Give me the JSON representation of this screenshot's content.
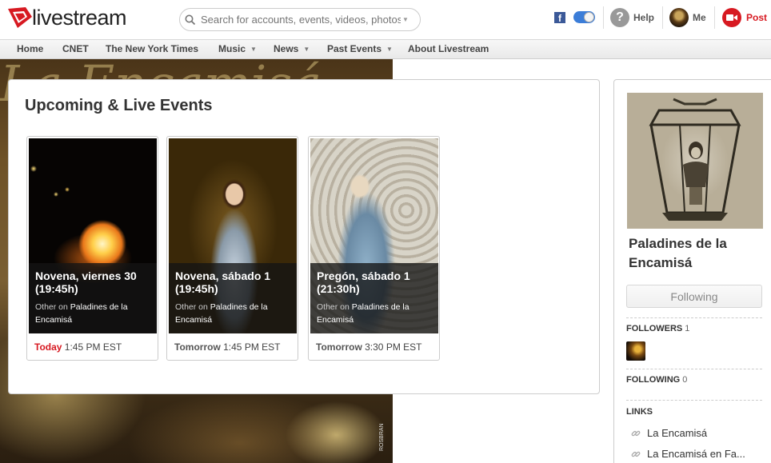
{
  "header": {
    "logo_text": "livestream",
    "search_placeholder": "Search for accounts, events, videos, photos...",
    "fb_glyph": "f",
    "help_label": "Help",
    "me_label": "Me",
    "post_label": "Post"
  },
  "nav": {
    "items": [
      {
        "label": "Home"
      },
      {
        "label": "CNET"
      },
      {
        "label": "The New York Times"
      },
      {
        "label": "Music",
        "dropdown": true
      },
      {
        "label": "News",
        "dropdown": true
      },
      {
        "label": "Past Events",
        "dropdown": true
      },
      {
        "label": "About Livestream"
      }
    ]
  },
  "background": {
    "script_text": "La Encamisá",
    "watermark": "ROSBRAN"
  },
  "events": {
    "title": "Upcoming & Live Events",
    "cards": [
      {
        "title": "Novena, viernes 30 (19:45h)",
        "other_on": "Other on",
        "account": "Paladines de la Encamisá",
        "day": "Today",
        "time": "1:45 PM EST",
        "is_today": true
      },
      {
        "title": "Novena, sábado 1 (19:45h)",
        "other_on": "Other on",
        "account": "Paladines de la Encamisá",
        "day": "Tomorrow",
        "time": "1:45 PM EST",
        "is_today": false
      },
      {
        "title": "Pregón, sábado 1 (21:30h)",
        "other_on": "Other on",
        "account": "Paladines de la Encamisá",
        "day": "Tomorrow",
        "time": "3:30 PM EST",
        "is_today": false
      }
    ]
  },
  "sidebar": {
    "account_name": "Paladines de la Encamisá",
    "follow_button": "Following",
    "followers_label": "FOLLOWERS",
    "followers_count": "1",
    "following_label": "FOLLOWING",
    "following_count": "0",
    "links_label": "LINKS",
    "links": [
      {
        "label": "La Encamisá"
      },
      {
        "label": "La Encamisá en Fa..."
      }
    ]
  },
  "colors": {
    "brand_red": "#d71921",
    "facebook_blue": "#3b5998"
  }
}
